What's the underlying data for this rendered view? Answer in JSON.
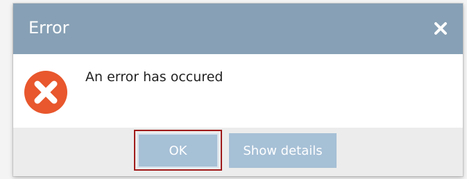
{
  "dialog": {
    "title": "Error",
    "message": "An error has occured",
    "close_icon": "close-icon",
    "status_icon": "error-circle-x-icon",
    "colors": {
      "titlebar": "#87a0b5",
      "button": "#a6c0d6",
      "error_icon": "#e8572d",
      "focus_ring": "#a01b1b"
    }
  },
  "buttons": {
    "ok_label": "OK",
    "details_label": "Show details"
  }
}
